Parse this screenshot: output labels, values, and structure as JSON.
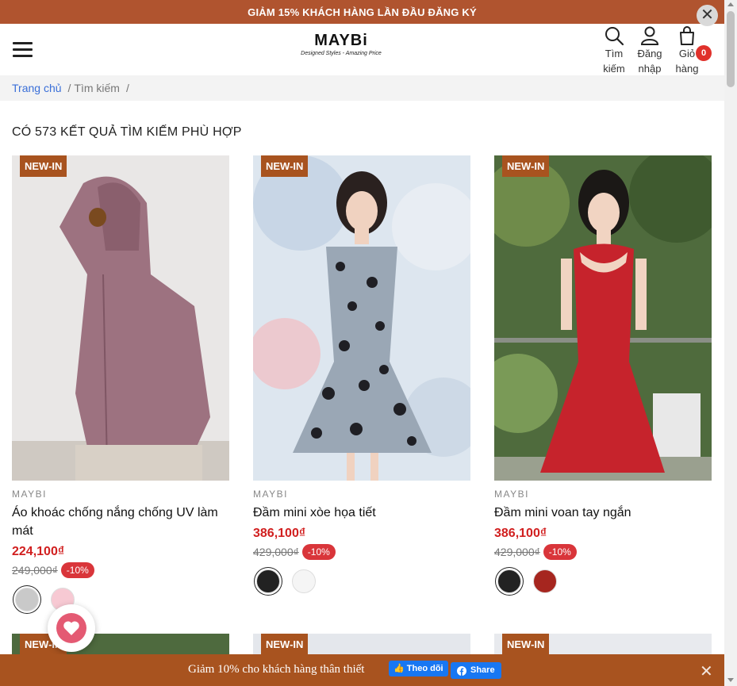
{
  "promo": {
    "text": "GIẢM 15% KHÁCH HÀNG LẦN ĐẦU ĐĂNG KÝ",
    "close": "✕"
  },
  "header": {
    "logo_word": "MAYBi",
    "logo_tagline": "Designed Styles - Amazing Price",
    "search_label": "Tìm kiếm",
    "login_label": "Đăng nhập",
    "cart_label": "Giỏ hàng",
    "cart_count": "0"
  },
  "breadcrumb": {
    "home": "Trang chủ",
    "sep": "/",
    "current": "Tìm kiếm"
  },
  "results_title": "CÓ 573 KẾT QUẢ TÌM KIẾM PHÙ HỢP",
  "products": [
    {
      "badge": "NEW-IN",
      "brand": "MAYBI",
      "name": "Áo khoác chống nắng chống UV làm mát",
      "price": "224,100₫",
      "old_price": "249,000₫",
      "discount": "-10%",
      "swatches": [
        "#c9c9c9",
        "#f7c9d3"
      ]
    },
    {
      "badge": "NEW-IN",
      "brand": "MAYBI",
      "name": "Đầm mini xòe họa tiết",
      "price": "386,100₫",
      "old_price": "429,000₫",
      "discount": "-10%",
      "swatches": [
        "#222222",
        "#f5f5f5"
      ]
    },
    {
      "badge": "NEW-IN",
      "brand": "MAYBI",
      "name": "Đầm mini voan tay ngắn",
      "price": "386,100₫",
      "old_price": "429,000₫",
      "discount": "-10%",
      "swatches": [
        "#222222",
        "#a6261f"
      ]
    }
  ],
  "row2_badges": [
    "NEW-IN",
    "NEW-IN",
    "NEW-IN"
  ],
  "bottom_bar": {
    "text": "Giảm 10% cho khách hàng thân thiết",
    "follow": "Theo dõi",
    "share": "Share",
    "close": "✕"
  },
  "colors": {
    "accent": "#a8531f",
    "promo": "#b0542f",
    "sale": "#d11f1f",
    "link": "#3a6fd8"
  }
}
